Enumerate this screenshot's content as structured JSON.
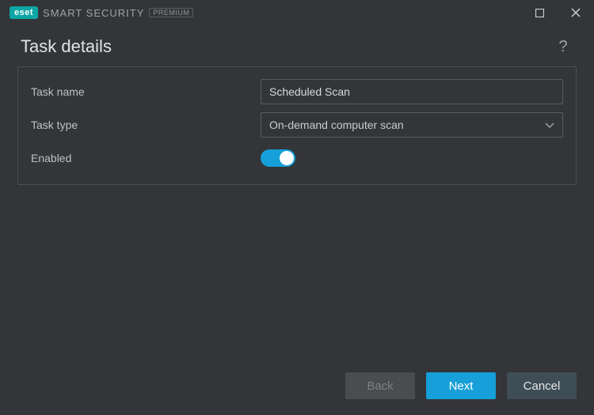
{
  "brand": {
    "logo_text": "eset",
    "product": "SMART SECURITY",
    "edition": "PREMIUM"
  },
  "title": "Task details",
  "help_symbol": "?",
  "form": {
    "task_name": {
      "label": "Task name",
      "value": "Scheduled Scan"
    },
    "task_type": {
      "label": "Task type",
      "value": "On-demand computer scan"
    },
    "enabled": {
      "label": "Enabled",
      "value": true
    }
  },
  "footer": {
    "back": "Back",
    "next": "Next",
    "cancel": "Cancel"
  },
  "colors": {
    "accent": "#169fd8",
    "brand_teal": "#0ea5a5",
    "bg": "#333538"
  }
}
